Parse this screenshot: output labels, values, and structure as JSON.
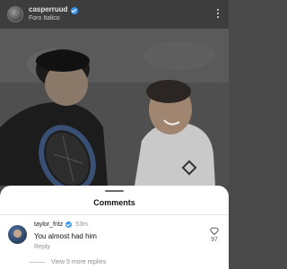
{
  "post": {
    "username": "casperruud",
    "location": "Foro Italico"
  },
  "comments_sheet": {
    "title": "Comments",
    "comment": {
      "username": "taylor_fritz",
      "time": "53m",
      "text": "You almost had him",
      "reply_label": "Reply",
      "likes": "97"
    },
    "view_more_label": "View 5 more replies"
  },
  "colors": {
    "verified": "#3897f0",
    "overlay": "#3d3d3d"
  }
}
